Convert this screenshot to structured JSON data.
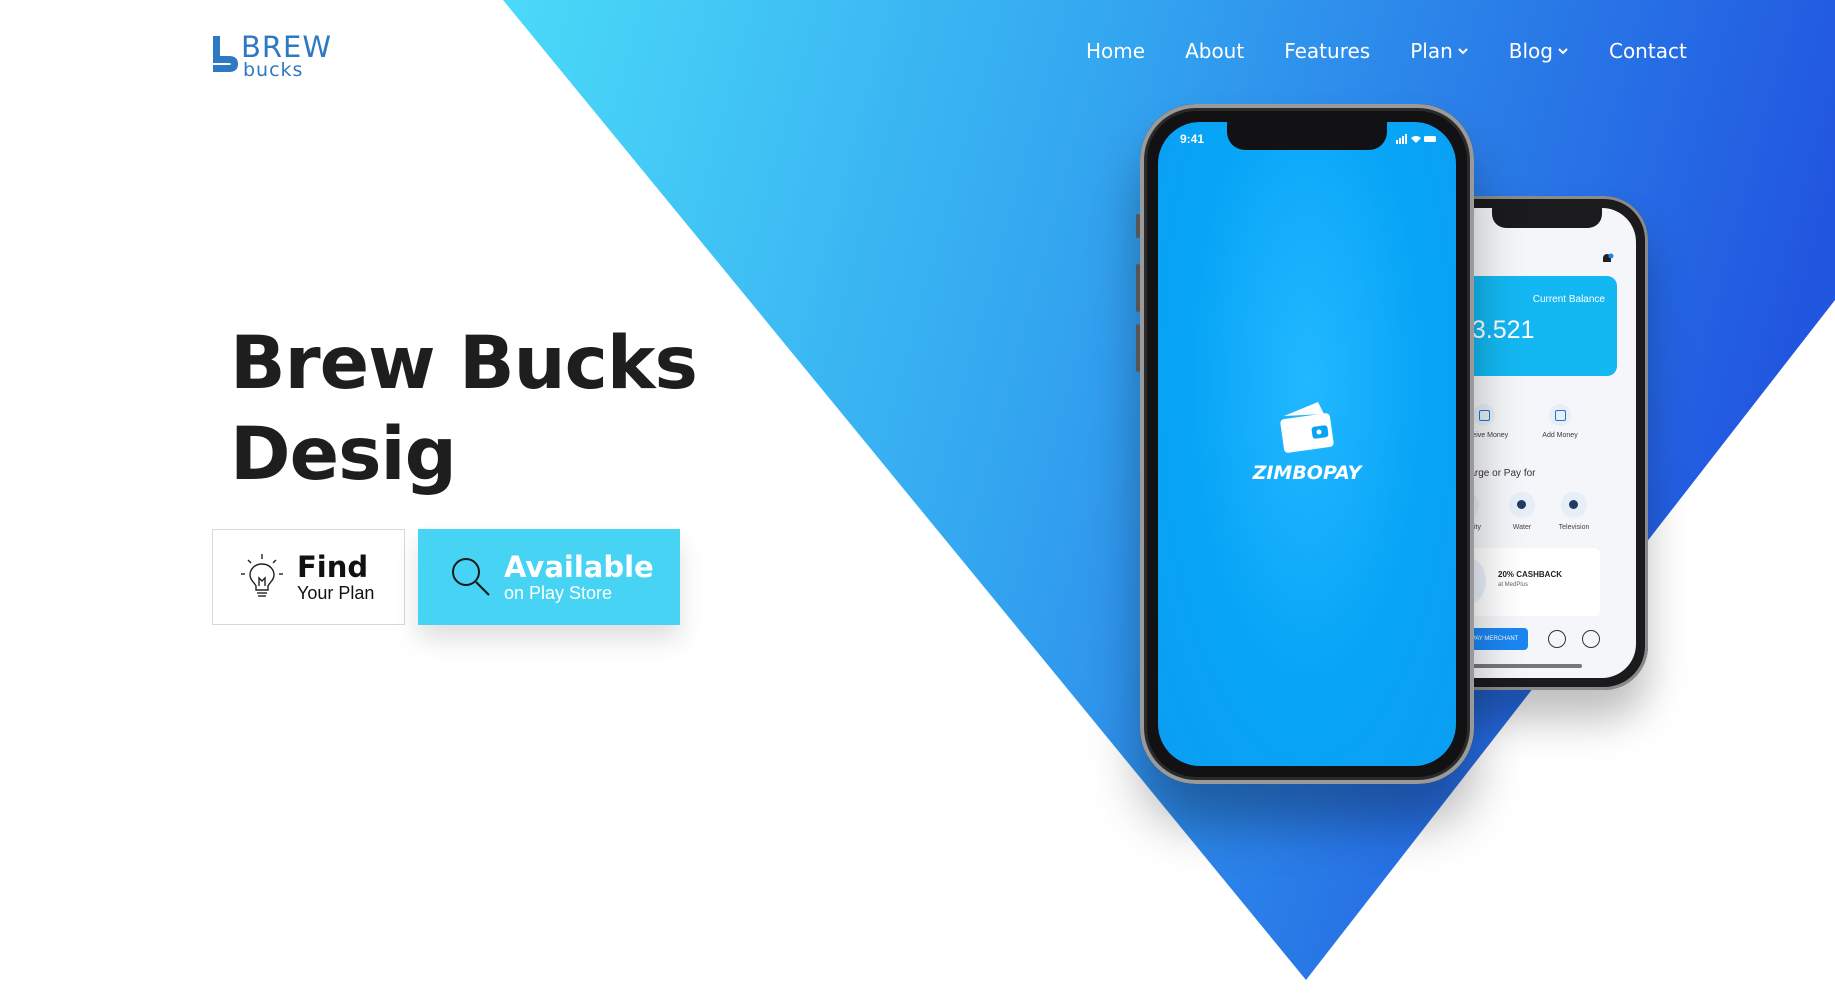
{
  "brand": {
    "logo_line1": "BREW",
    "logo_line2": "bucks",
    "color": "#2f78c4"
  },
  "nav": {
    "items": [
      {
        "label": "Home",
        "has_dropdown": false
      },
      {
        "label": "About",
        "has_dropdown": false
      },
      {
        "label": "Features",
        "has_dropdown": false
      },
      {
        "label": "Plan",
        "has_dropdown": true
      },
      {
        "label": "Blog",
        "has_dropdown": true
      },
      {
        "label": "Contact",
        "has_dropdown": false
      }
    ]
  },
  "hero": {
    "title_line1": "Brew Bucks",
    "title_line2": "Desig"
  },
  "cta": {
    "find": {
      "main": "Find",
      "sub": "Your Plan",
      "icon": "lightbulb-icon"
    },
    "play": {
      "main": "Available",
      "sub": "on Play Store",
      "icon": "search-icon",
      "color": "#47d4f4"
    }
  },
  "phone_front": {
    "time": "9:41",
    "app_name": "ZIMBOPAY",
    "screen_color": "#08a5f7"
  },
  "phone_back": {
    "balance_label": "Current Balance",
    "balance_value": "$3.521",
    "quick_actions": [
      "Receive Money",
      "Add Money"
    ],
    "recharge_title": "Recharge or Pay for",
    "recharge_items": [
      "Electricity",
      "Water",
      "Television"
    ],
    "cashback_main": "20% CASHBACK",
    "cashback_sub": "at MedPlus",
    "pay_button": "PAY MERCHANT"
  },
  "colors": {
    "gradient_start": "#4adaf8",
    "gradient_end": "#2156e0"
  }
}
